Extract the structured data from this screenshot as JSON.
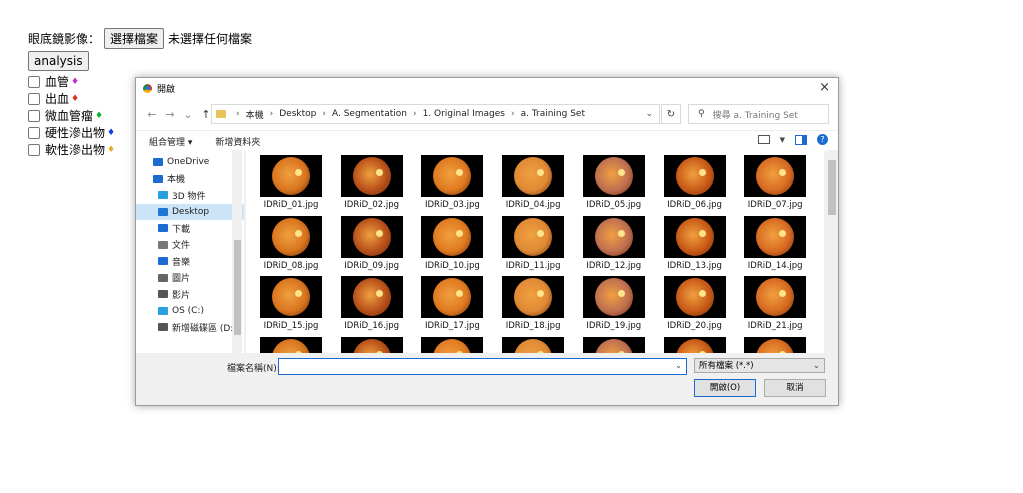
{
  "form": {
    "label": "眼底鏡影像：",
    "choose_button": "選擇檔案",
    "no_file_text": "未選擇任何檔案",
    "analysis_button": "analysis",
    "checkboxes": [
      {
        "label": "血管",
        "diamond": "♦",
        "color": "#c030d0"
      },
      {
        "label": "出血",
        "diamond": "♦",
        "color": "#e03020"
      },
      {
        "label": "微血管瘤",
        "diamond": "♦",
        "color": "#10b030"
      },
      {
        "label": "硬性滲出物",
        "diamond": "♦",
        "color": "#1040e0"
      },
      {
        "label": "軟性滲出物",
        "diamond": "♦",
        "color": "#e0b020"
      }
    ]
  },
  "dialog": {
    "title": "開啟",
    "close_icon": "×",
    "nav_back": "←",
    "nav_forward": "→",
    "nav_recent": "⌄",
    "nav_up": "↑",
    "breadcrumb": [
      "本機",
      "Desktop",
      "A. Segmentation",
      "1. Original Images",
      "a. Training Set"
    ],
    "search_placeholder": "搜尋 a. Training Set",
    "toolbar": {
      "organize": "組合管理 ▾",
      "new_folder": "新增資料夾"
    },
    "nav_pane": [
      {
        "label": "OneDrive",
        "icon": "cloud-icon",
        "color": "#1c6bd1",
        "child": false
      },
      {
        "label": "本機",
        "icon": "computer-icon",
        "color": "#1c6bd1",
        "child": false
      },
      {
        "label": "3D 物件",
        "icon": "3d-objects-icon",
        "color": "#2aa0e0",
        "child": true
      },
      {
        "label": "Desktop",
        "icon": "desktop-icon",
        "color": "#1c78d4",
        "child": true,
        "selected": true
      },
      {
        "label": "下載",
        "icon": "download-icon",
        "color": "#1c6bd1",
        "child": true
      },
      {
        "label": "文件",
        "icon": "document-icon",
        "color": "#777777",
        "child": true
      },
      {
        "label": "音樂",
        "icon": "music-icon",
        "color": "#1c6bd1",
        "child": true
      },
      {
        "label": "圖片",
        "icon": "pictures-icon",
        "color": "#666666",
        "child": true
      },
      {
        "label": "影片",
        "icon": "video-icon",
        "color": "#555555",
        "child": true
      },
      {
        "label": "OS (C:)",
        "icon": "drive-icon",
        "color": "#2aa0e0",
        "child": true
      },
      {
        "label": "新增磁碟區 (D:)",
        "icon": "drive-icon",
        "color": "#555555",
        "child": true
      }
    ],
    "files": [
      "IDRiD_01.jpg",
      "IDRiD_02.jpg",
      "IDRiD_03.jpg",
      "IDRiD_04.jpg",
      "IDRiD_05.jpg",
      "IDRiD_06.jpg",
      "IDRiD_07.jpg",
      "IDRiD_08.jpg",
      "IDRiD_09.jpg",
      "IDRiD_10.jpg",
      "IDRiD_11.jpg",
      "IDRiD_12.jpg",
      "IDRiD_13.jpg",
      "IDRiD_14.jpg",
      "IDRiD_15.jpg",
      "IDRiD_16.jpg",
      "IDRiD_17.jpg",
      "IDRiD_18.jpg",
      "IDRiD_19.jpg",
      "IDRiD_20.jpg",
      "IDRiD_21.jpg",
      "",
      "",
      "",
      "",
      "",
      "",
      ""
    ],
    "file_name_label": "檔案名稱(N):",
    "file_name_value": "",
    "file_type": "所有檔案 (*.*)",
    "open_button": "開啟(O)",
    "cancel_button": "取消"
  }
}
